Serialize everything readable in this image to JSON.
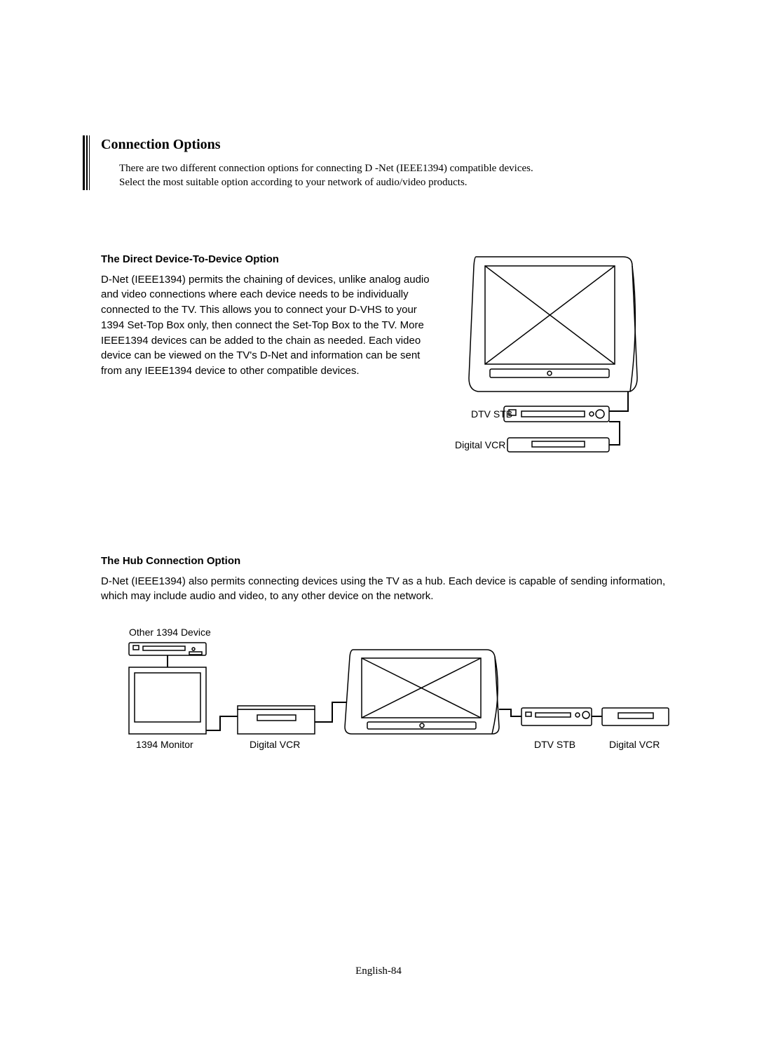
{
  "section": {
    "title": "Connection Options",
    "intro_line1": "There are two different connection options for connecting D -Net (IEEE1394) compatible devices.",
    "intro_line2": "Select the most suitable option according to your network of audio/video products."
  },
  "direct": {
    "title": "The Direct Device-To-Device Option",
    "body": "D-Net (IEEE1394) permits the chaining of devices, unlike analog audio and video connections where each device needs to be individually connected to the TV. This allows you to connect your D-VHS to your 1394 Set-Top Box only, then connect the Set-Top Box to the TV. More IEEE1394 devices can be added to the chain as needed. Each video device can be viewed on the TV's  D-Net and information can be sent from any IEEE1394 device to other compatible devices.",
    "label_dtv_stb": "DTV STB",
    "label_digital_vcr": "Digital VCR"
  },
  "hub": {
    "title": "The Hub Connection Option",
    "body": "D-Net (IEEE1394) also permits connecting devices using the TV as a hub. Each device is capable of sending information, which may include audio and video, to any other device on the network.",
    "label_other_1394": "Other 1394 Device",
    "label_1394_monitor": "1394 Monitor",
    "label_digital_vcr_left": "Digital VCR",
    "label_dtv_stb": "DTV STB",
    "label_digital_vcr_right": "Digital VCR"
  },
  "page_number": "English-84"
}
